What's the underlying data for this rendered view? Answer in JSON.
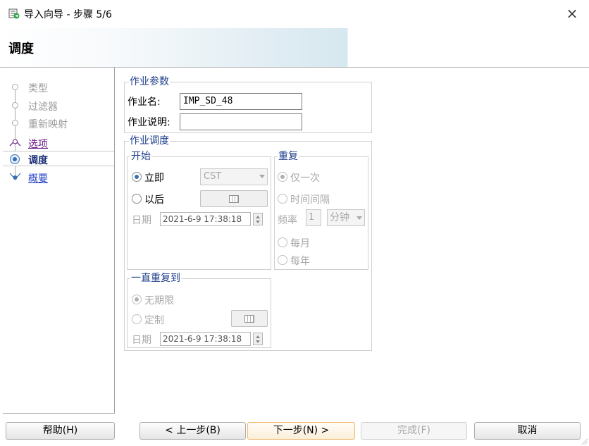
{
  "window": {
    "title": "导入向导 - 步骤 5/6",
    "close_glyph": "×",
    "app_icon": "wizard-icon"
  },
  "header": {
    "title": "调度"
  },
  "nav": {
    "steps": [
      {
        "label": "类型",
        "state": "done"
      },
      {
        "label": "过滤器",
        "state": "done"
      },
      {
        "label": "重新映射",
        "state": "done"
      },
      {
        "label": "选项",
        "state": "visited"
      },
      {
        "label": "调度",
        "state": "current"
      },
      {
        "label": "概要",
        "state": "future"
      }
    ]
  },
  "job_params": {
    "legend": "作业参数",
    "name_label": "作业名:",
    "name_value": "IMP_SD_48",
    "desc_label": "作业说明:",
    "desc_value": ""
  },
  "job_schedule": {
    "legend": "作业调度",
    "start": {
      "legend": "开始",
      "immediate_label": "立即",
      "immediate_checked": true,
      "later_label": "以后",
      "timezone_value": "CST",
      "date_label": "日期",
      "date_value": "2021-6-9 17:38:18"
    },
    "repeat": {
      "legend": "重复",
      "once_label": "仅一次",
      "interval_label": "时间间隔",
      "freq_label": "频率",
      "freq_value": "1",
      "freq_unit": "分钟",
      "monthly_label": "每月",
      "yearly_label": "每年"
    },
    "repeat_until": {
      "legend": "一直重复到",
      "unlimited_label": "无期限",
      "custom_label": "定制",
      "date_label": "日期",
      "date_value": "2021-6-9 17:38:18"
    }
  },
  "buttons": {
    "help": "帮助(H)",
    "back": "< 上一步(B)",
    "next": "下一步(N) >",
    "finish": "完成(F)",
    "cancel": "取消"
  },
  "colors": {
    "legend": "#1f3e8c",
    "current_step": "#1a2f78",
    "visited_step": "#6a1a86",
    "future_step": "#1e3cc8",
    "primary_button_border": "#f0b96a"
  }
}
